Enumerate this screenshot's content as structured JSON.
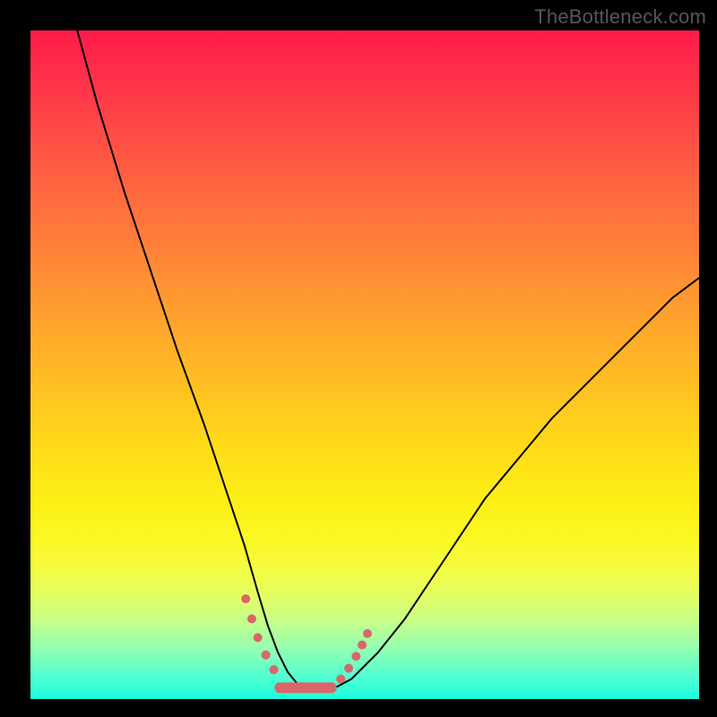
{
  "watermark": "TheBottleneck.com",
  "chart_data": {
    "type": "line",
    "title": "",
    "xlabel": "",
    "ylabel": "",
    "xlim": [
      0,
      100
    ],
    "ylim": [
      0,
      100
    ],
    "grid": false,
    "legend": false,
    "series": [
      {
        "name": "curve",
        "color": "#000000",
        "stroke_width": 2,
        "x": [
          7,
          10,
          14,
          18,
          22,
          26,
          29,
          32,
          34,
          35.5,
          37,
          38.5,
          40,
          41.5,
          43,
          45,
          48,
          52,
          56,
          60,
          64,
          68,
          73,
          78,
          84,
          90,
          96,
          100
        ],
        "y": [
          100,
          89,
          76,
          64,
          52,
          41,
          32,
          23,
          16,
          11,
          7,
          4,
          2.2,
          1.4,
          1.2,
          1.4,
          3,
          7,
          12,
          18,
          24,
          30,
          36,
          42,
          48,
          54,
          60,
          63
        ]
      },
      {
        "name": "bottom-markers-left",
        "type": "scatter",
        "color": "#d9666b",
        "marker_size": 10,
        "x": [
          32.2,
          33.1,
          34.0,
          35.2,
          36.4
        ],
        "y": [
          15.0,
          12.0,
          9.2,
          6.6,
          4.4
        ]
      },
      {
        "name": "bottom-plateau",
        "type": "line",
        "color": "#d9666b",
        "stroke_width": 12,
        "x": [
          37.3,
          45.0
        ],
        "y": [
          1.7,
          1.7
        ]
      },
      {
        "name": "bottom-markers-right",
        "type": "scatter",
        "color": "#d9666b",
        "marker_size": 10,
        "x": [
          46.4,
          47.6,
          48.7,
          49.6,
          50.4
        ],
        "y": [
          3.0,
          4.6,
          6.4,
          8.1,
          9.8
        ]
      }
    ]
  }
}
